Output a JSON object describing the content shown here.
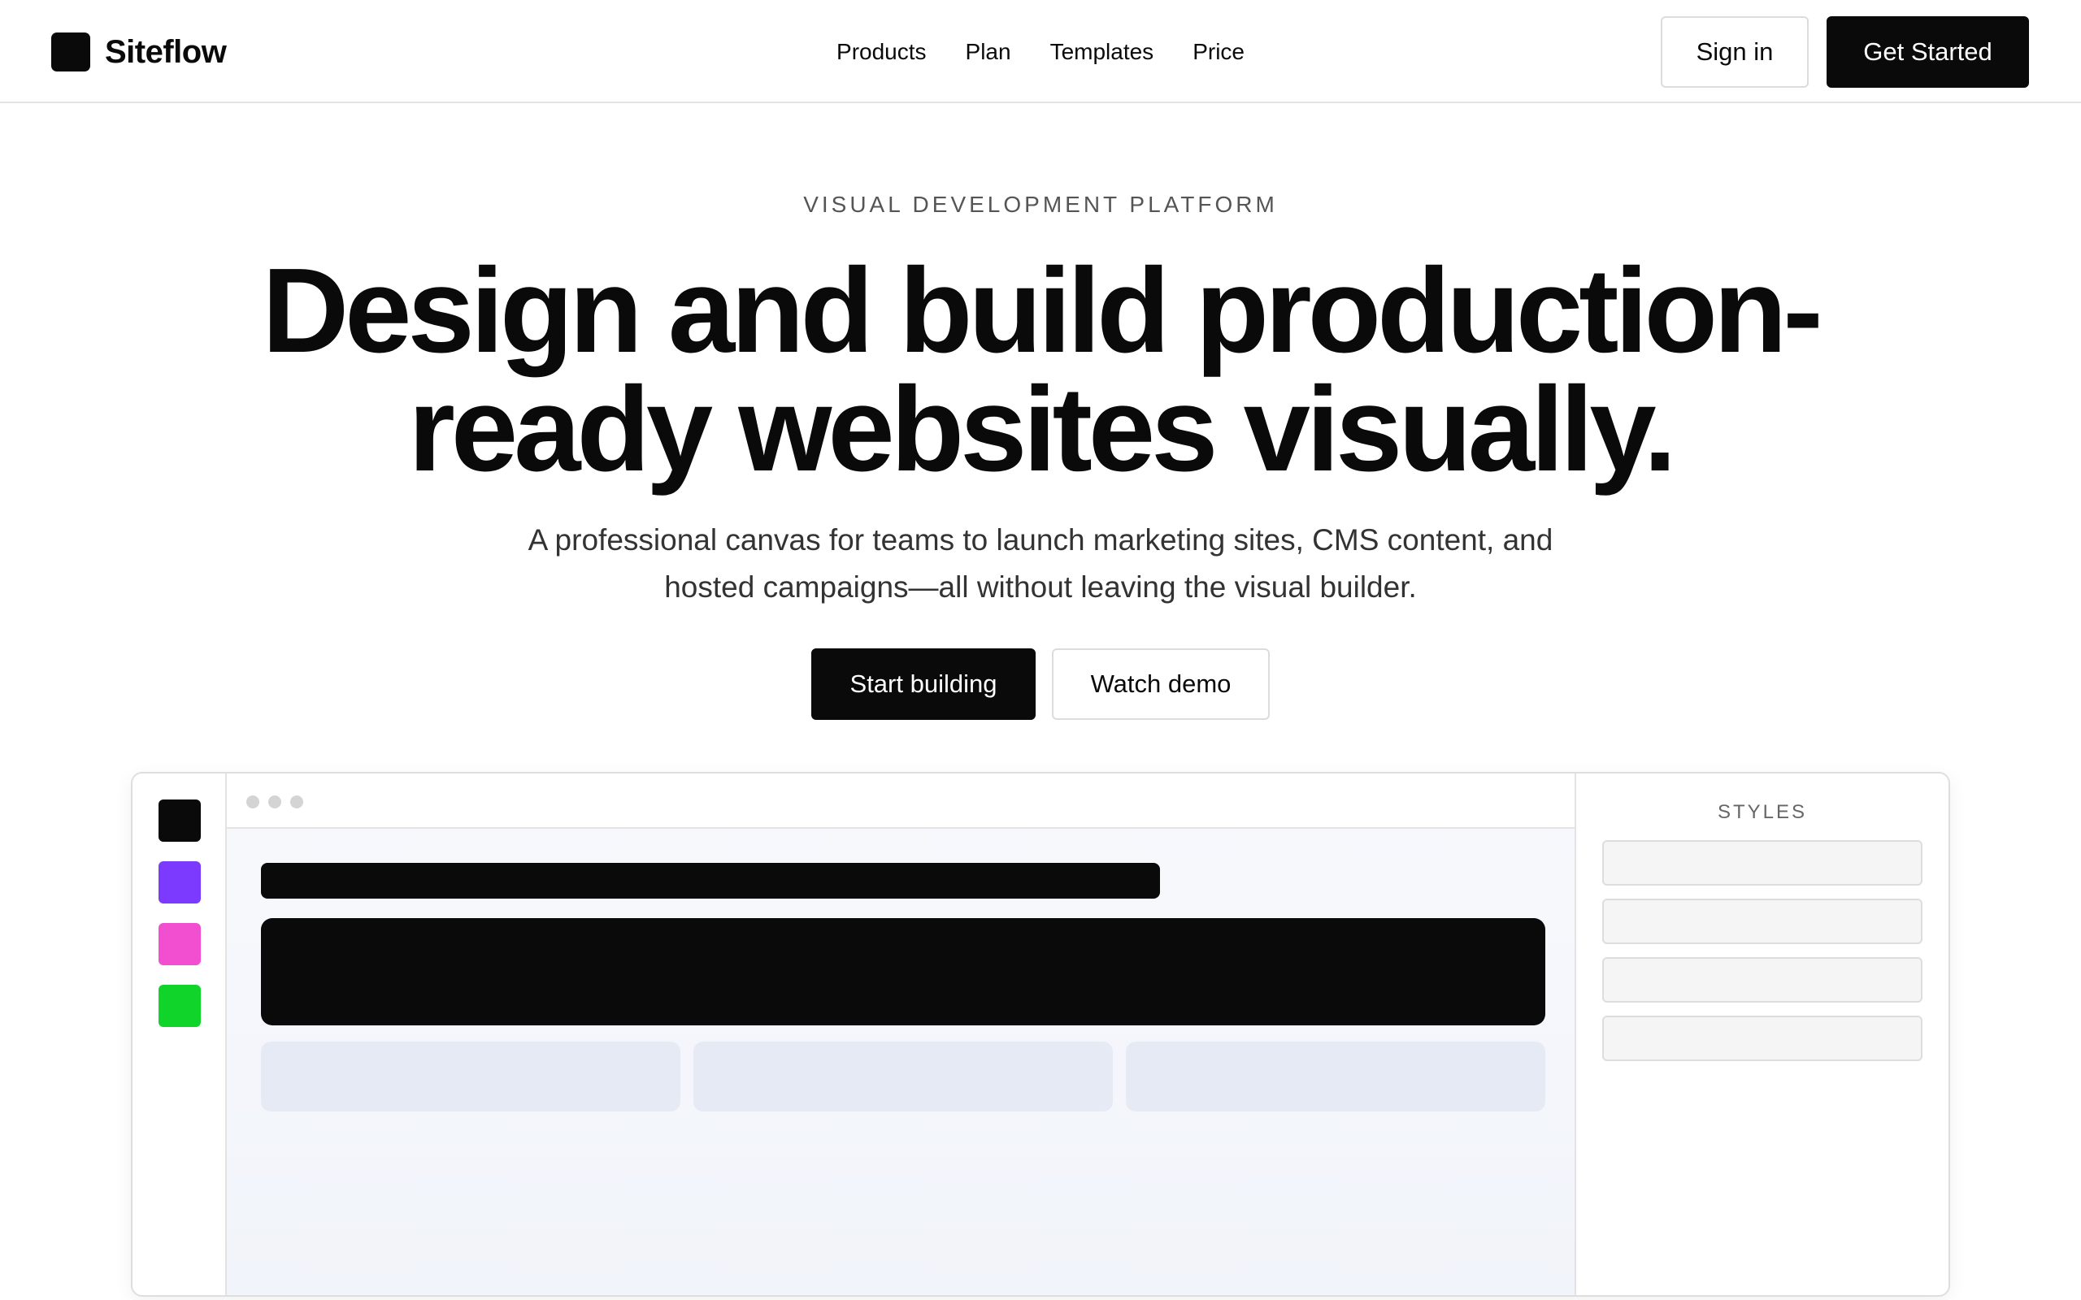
{
  "brand": {
    "name": "Siteflow",
    "icon": "logo-square-icon"
  },
  "nav": {
    "links": [
      "Products",
      "Plan",
      "Templates",
      "Price"
    ],
    "sign_in": "Sign in",
    "get_started": "Get Started"
  },
  "hero": {
    "eyebrow": "VISUAL DEVELOPMENT PLATFORM",
    "headline": "Design and build production-ready websites visually.",
    "subhead": "A professional canvas for teams to launch marketing sites, CMS content, and hosted campaigns—all without leaving the visual builder.",
    "primary_cta": "Start building",
    "secondary_cta": "Watch demo"
  },
  "preview": {
    "swatches": [
      "#0a0a0a",
      "#7c3aff",
      "#f24fd0",
      "#10d42a"
    ],
    "styles_title": "STYLES"
  },
  "colors": {
    "text": "#0a0a0a",
    "accent": "#0a0a0a",
    "border": "#e3e3e3"
  }
}
